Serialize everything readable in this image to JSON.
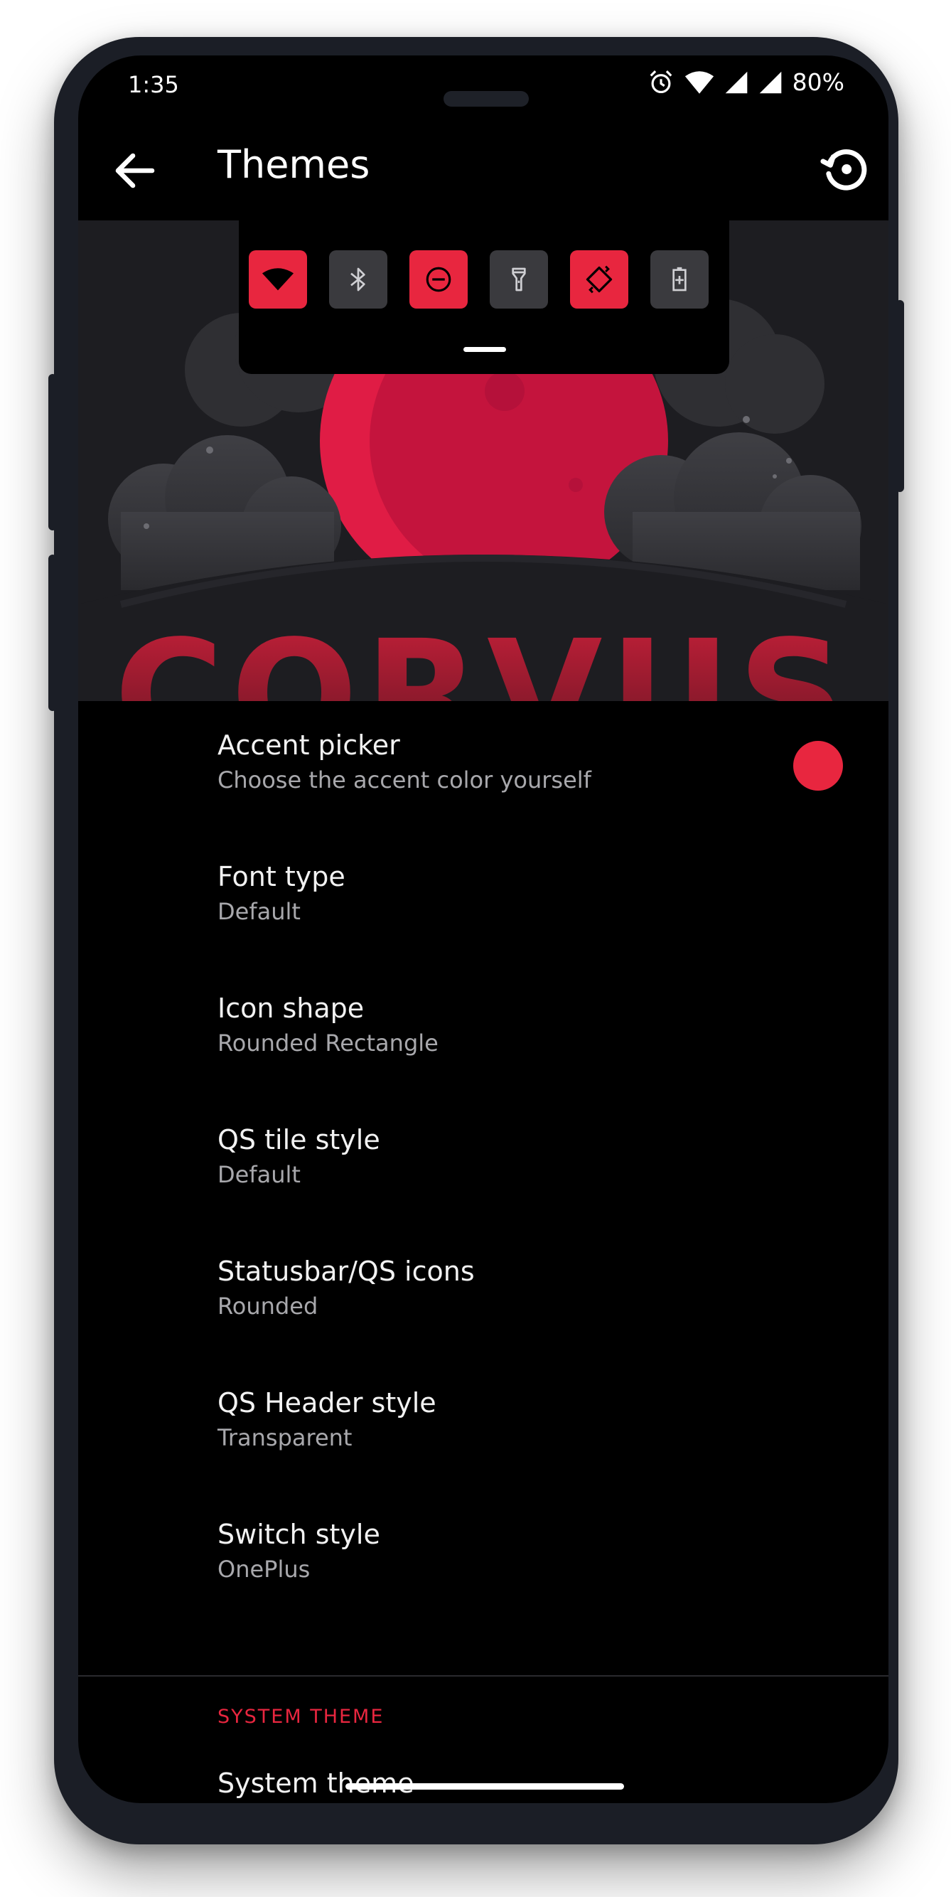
{
  "status_bar": {
    "time": "1:35",
    "battery": "80%",
    "icons": [
      "alarm-icon",
      "wifi-icon",
      "signal-icon",
      "signal-icon"
    ]
  },
  "toolbar": {
    "title": "Themes",
    "back_icon": "arrow-left-icon",
    "reset_icon": "restore-icon"
  },
  "preview": {
    "qs_tiles": [
      {
        "icon": "wifi-icon",
        "state": "on"
      },
      {
        "icon": "bluetooth-icon",
        "state": "off"
      },
      {
        "icon": "dnd-icon",
        "state": "on"
      },
      {
        "icon": "flashlight-icon",
        "state": "off"
      },
      {
        "icon": "auto-rotate-icon",
        "state": "on"
      },
      {
        "icon": "battery-saver-icon",
        "state": "off"
      }
    ],
    "logo_text": "CORVUS"
  },
  "settings": {
    "items": [
      {
        "title": "Accent picker",
        "subtitle": "Choose the accent color yourself"
      },
      {
        "title": "Font type",
        "subtitle": "Default"
      },
      {
        "title": "Icon shape",
        "subtitle": "Rounded Rectangle"
      },
      {
        "title": "QS tile style",
        "subtitle": "Default"
      },
      {
        "title": "Statusbar/QS icons",
        "subtitle": "Rounded"
      },
      {
        "title": "QS Header style",
        "subtitle": "Transparent"
      },
      {
        "title": "Switch style",
        "subtitle": "OnePlus"
      }
    ],
    "section_header": "SYSTEM THEME",
    "system_theme_title": "System theme"
  },
  "colors": {
    "accent": "#e8263f",
    "background": "#000000",
    "frame": "#1b1e26"
  }
}
